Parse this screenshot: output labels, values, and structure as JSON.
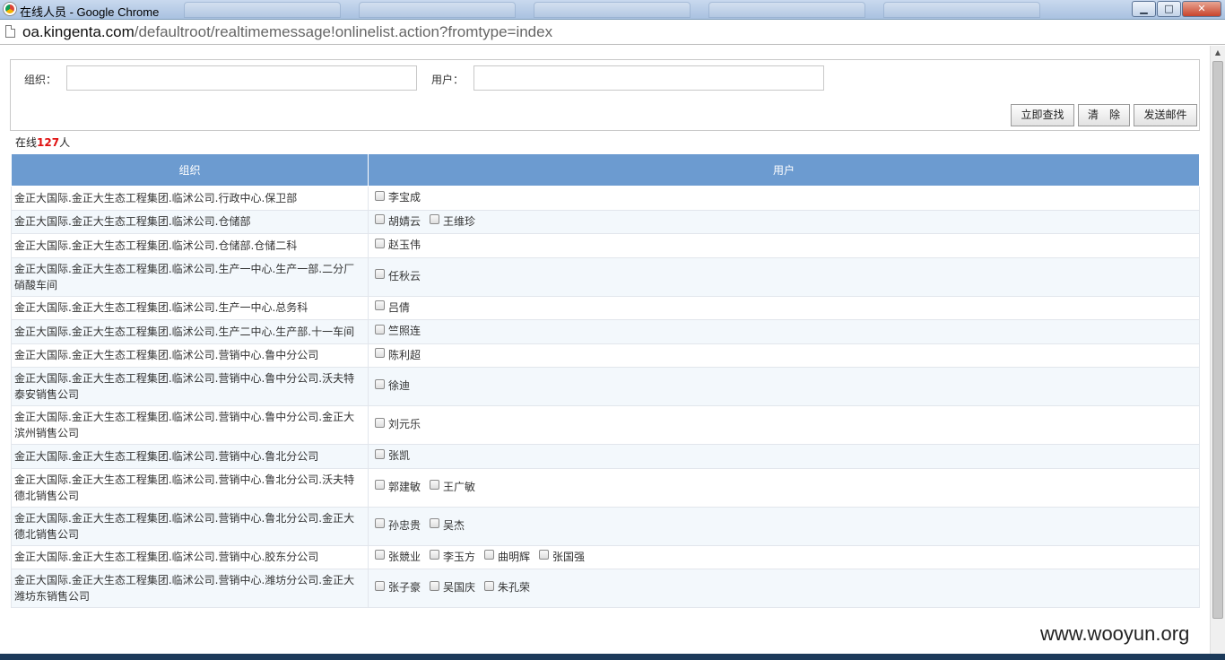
{
  "window": {
    "title": "在线人员 - Google Chrome",
    "buttons": {
      "minimize": "▁",
      "maximize": "□",
      "close": "✕"
    }
  },
  "address": {
    "host": "oa.kingenta.com",
    "path": "/defaultroot/realtimemessage!onlinelist.action?fromtype=index"
  },
  "search": {
    "org_label": "组织：",
    "org_value": "",
    "user_label": "用户：",
    "user_value": "",
    "buttons": {
      "search": "立即查找",
      "clear": "清　除",
      "email": "发送邮件"
    }
  },
  "summary": {
    "prefix": "在线",
    "count": "127",
    "suffix": "人"
  },
  "table": {
    "headers": {
      "org": "组织",
      "user": "用户"
    },
    "rows": [
      {
        "org": "金正大国际.金正大生态工程集团.临沭公司.行政中心.保卫部",
        "users": [
          "李宝成"
        ]
      },
      {
        "org": "金正大国际.金正大生态工程集团.临沭公司.仓储部",
        "users": [
          "胡婧云",
          "王维珍"
        ]
      },
      {
        "org": "金正大国际.金正大生态工程集团.临沭公司.仓储部.仓储二科",
        "users": [
          "赵玉伟"
        ]
      },
      {
        "org": "金正大国际.金正大生态工程集团.临沭公司.生产一中心.生产一部.二分厂硝酸车间",
        "users": [
          "任秋云"
        ]
      },
      {
        "org": "金正大国际.金正大生态工程集团.临沭公司.生产一中心.总务科",
        "users": [
          "吕倩"
        ]
      },
      {
        "org": "金正大国际.金正大生态工程集团.临沭公司.生产二中心.生产部.十一车间",
        "users": [
          "竺照连"
        ]
      },
      {
        "org": "金正大国际.金正大生态工程集团.临沭公司.营销中心.鲁中分公司",
        "users": [
          "陈利超"
        ]
      },
      {
        "org": "金正大国际.金正大生态工程集团.临沭公司.营销中心.鲁中分公司.沃夫特泰安销售公司",
        "users": [
          "徐迪"
        ]
      },
      {
        "org": "金正大国际.金正大生态工程集团.临沭公司.营销中心.鲁中分公司.金正大滨州销售公司",
        "users": [
          "刘元乐"
        ]
      },
      {
        "org": "金正大国际.金正大生态工程集团.临沭公司.营销中心.鲁北分公司",
        "users": [
          "张凯"
        ]
      },
      {
        "org": "金正大国际.金正大生态工程集团.临沭公司.营销中心.鲁北分公司.沃夫特德北销售公司",
        "users": [
          "郭建敏",
          "王广敏"
        ]
      },
      {
        "org": "金正大国际.金正大生态工程集团.临沭公司.营销中心.鲁北分公司.金正大德北销售公司",
        "users": [
          "孙忠贵",
          "吴杰"
        ]
      },
      {
        "org": "金正大国际.金正大生态工程集团.临沭公司.营销中心.胶东分公司",
        "users": [
          "张競业",
          "李玉方",
          "曲明辉",
          "张国强"
        ]
      },
      {
        "org": "金正大国际.金正大生态工程集团.临沭公司.营销中心.潍坊分公司.金正大潍坊东销售公司",
        "users": [
          "张子豪",
          "吴国庆",
          "朱孔荣"
        ]
      }
    ]
  },
  "watermark": "www.wooyun.org"
}
